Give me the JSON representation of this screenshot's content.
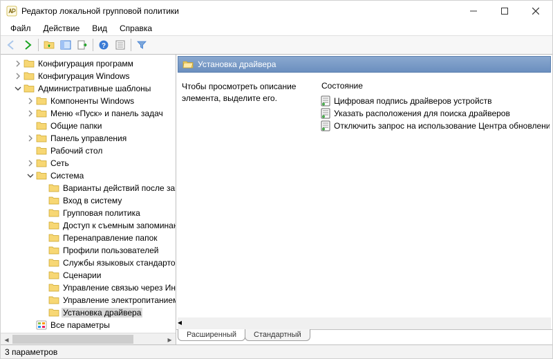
{
  "window": {
    "title": "Редактор локальной групповой политики"
  },
  "menubar": {
    "file": "Файл",
    "action": "Действие",
    "view": "Вид",
    "help": "Справка"
  },
  "tree": [
    {
      "depth": 1,
      "expander": "collapsed",
      "icon": "folder",
      "label": "Конфигурация программ"
    },
    {
      "depth": 1,
      "expander": "collapsed",
      "icon": "folder",
      "label": "Конфигурация Windows"
    },
    {
      "depth": 1,
      "expander": "expanded",
      "icon": "folder",
      "label": "Административные шаблоны"
    },
    {
      "depth": 2,
      "expander": "collapsed",
      "icon": "folder",
      "label": "Компоненты Windows"
    },
    {
      "depth": 2,
      "expander": "collapsed",
      "icon": "folder",
      "label": "Меню «Пуск» и панель задач"
    },
    {
      "depth": 2,
      "expander": "none",
      "icon": "folder",
      "label": "Общие папки"
    },
    {
      "depth": 2,
      "expander": "collapsed",
      "icon": "folder",
      "label": "Панель управления"
    },
    {
      "depth": 2,
      "expander": "none",
      "icon": "folder",
      "label": "Рабочий стол"
    },
    {
      "depth": 2,
      "expander": "collapsed",
      "icon": "folder",
      "label": "Сеть"
    },
    {
      "depth": 2,
      "expander": "expanded",
      "icon": "folder",
      "label": "Система"
    },
    {
      "depth": 3,
      "expander": "none",
      "icon": "folder",
      "label": "Варианты действий после завершения"
    },
    {
      "depth": 3,
      "expander": "none",
      "icon": "folder",
      "label": "Вход в систему"
    },
    {
      "depth": 3,
      "expander": "none",
      "icon": "folder",
      "label": "Групповая политика"
    },
    {
      "depth": 3,
      "expander": "none",
      "icon": "folder",
      "label": "Доступ к съемным запоминающим"
    },
    {
      "depth": 3,
      "expander": "none",
      "icon": "folder",
      "label": "Перенаправление папок"
    },
    {
      "depth": 3,
      "expander": "none",
      "icon": "folder",
      "label": "Профили пользователей"
    },
    {
      "depth": 3,
      "expander": "none",
      "icon": "folder",
      "label": "Службы языковых стандартов"
    },
    {
      "depth": 3,
      "expander": "none",
      "icon": "folder",
      "label": "Сценарии"
    },
    {
      "depth": 3,
      "expander": "none",
      "icon": "folder",
      "label": "Управление связью через Интернет"
    },
    {
      "depth": 3,
      "expander": "none",
      "icon": "folder",
      "label": "Управление электропитанием"
    },
    {
      "depth": 3,
      "expander": "none",
      "icon": "folder",
      "label": "Установка драйвера",
      "selected": true
    },
    {
      "depth": 2,
      "expander": "none",
      "icon": "allsettings",
      "label": "Все параметры"
    }
  ],
  "right": {
    "header": "Установка драйвера",
    "description": "Чтобы просмотреть описание элемента, выделите его.",
    "column_header": "Состояние",
    "settings": [
      "Цифровая подпись драйверов устройств",
      "Указать расположения для поиска драйверов",
      "Отключить запрос на использование Центра обновления"
    ]
  },
  "tabs": {
    "extended": "Расширенный",
    "standard": "Стандартный"
  },
  "statusbar": {
    "text": "3 параметров"
  }
}
